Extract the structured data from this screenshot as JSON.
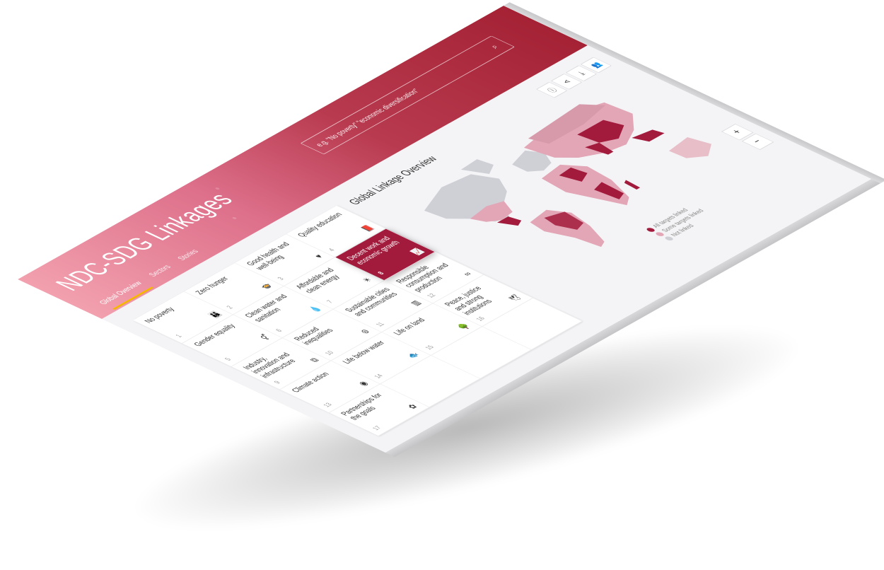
{
  "app": {
    "title": "NDC-SDG Linkages",
    "nav": [
      "Global Overview",
      "Sectors",
      "Stories"
    ]
  },
  "search": {
    "placeholder": "e.g. \"No poverty\" \"economic diversification\""
  },
  "colors": {
    "brand": "#a21a3c",
    "all_linked": "#a21a3c",
    "some_linked": "#e2a6b6",
    "not_linked": "#cfd0d6"
  },
  "goals": [
    {
      "label": "No poverty",
      "num": "1",
      "icon": "people-icon",
      "glyph": "👪"
    },
    {
      "label": "Zero hunger",
      "num": "2",
      "icon": "bowl-icon",
      "glyph": "🍲"
    },
    {
      "label": "Good health and well-being",
      "num": "3",
      "icon": "heartbeat-icon",
      "glyph": "♥"
    },
    {
      "label": "Quality education",
      "num": "4",
      "icon": "book-icon",
      "glyph": "📕"
    },
    {
      "label": "Gender equality",
      "num": "5",
      "icon": "gender-icon",
      "glyph": "⚥"
    },
    {
      "label": "Clean water and sanitation",
      "num": "6",
      "icon": "water-icon",
      "glyph": "💧"
    },
    {
      "label": "Affordable and clean energy",
      "num": "7",
      "icon": "sun-icon",
      "glyph": "☀"
    },
    {
      "label": "Decent work and economic growth",
      "num": "8",
      "icon": "growth-icon",
      "glyph": "📈"
    },
    {
      "label": "Industry, innovation and infrastructure",
      "num": "9",
      "icon": "cube-icon",
      "glyph": "⧉"
    },
    {
      "label": "Reduced inequalities",
      "num": "10",
      "icon": "equal-icon",
      "glyph": "⊜"
    },
    {
      "label": "Sustainable cities and communities",
      "num": "11",
      "icon": "city-icon",
      "glyph": "▥"
    },
    {
      "label": "Responsible consumption and production",
      "num": "12",
      "icon": "infinity-icon",
      "glyph": "∞"
    },
    {
      "label": "Climate action",
      "num": "13",
      "icon": "eye-icon",
      "glyph": "◉"
    },
    {
      "label": "Life below water",
      "num": "14",
      "icon": "fish-icon",
      "glyph": "🐟"
    },
    {
      "label": "Life on land",
      "num": "15",
      "icon": "tree-icon",
      "glyph": "🌳"
    },
    {
      "label": "Peace, justice and strong institutions",
      "num": "16",
      "icon": "dove-icon",
      "glyph": "🕊"
    },
    {
      "label": "Partnerships for the goals",
      "num": "17",
      "icon": "rings-icon",
      "glyph": "✿"
    }
  ],
  "map": {
    "title": "Global Linkage Overview",
    "tools": [
      {
        "icon": "info-icon",
        "glyph": "ⓘ"
      },
      {
        "icon": "share-icon",
        "glyph": "⋖"
      },
      {
        "icon": "download-icon",
        "glyph": "⤓"
      },
      {
        "icon": "users-icon",
        "glyph": "👥"
      }
    ],
    "zoom_in": "+",
    "zoom_out": "−",
    "legend": [
      "All targets linked",
      "Some targets linked",
      "Not linked"
    ]
  }
}
